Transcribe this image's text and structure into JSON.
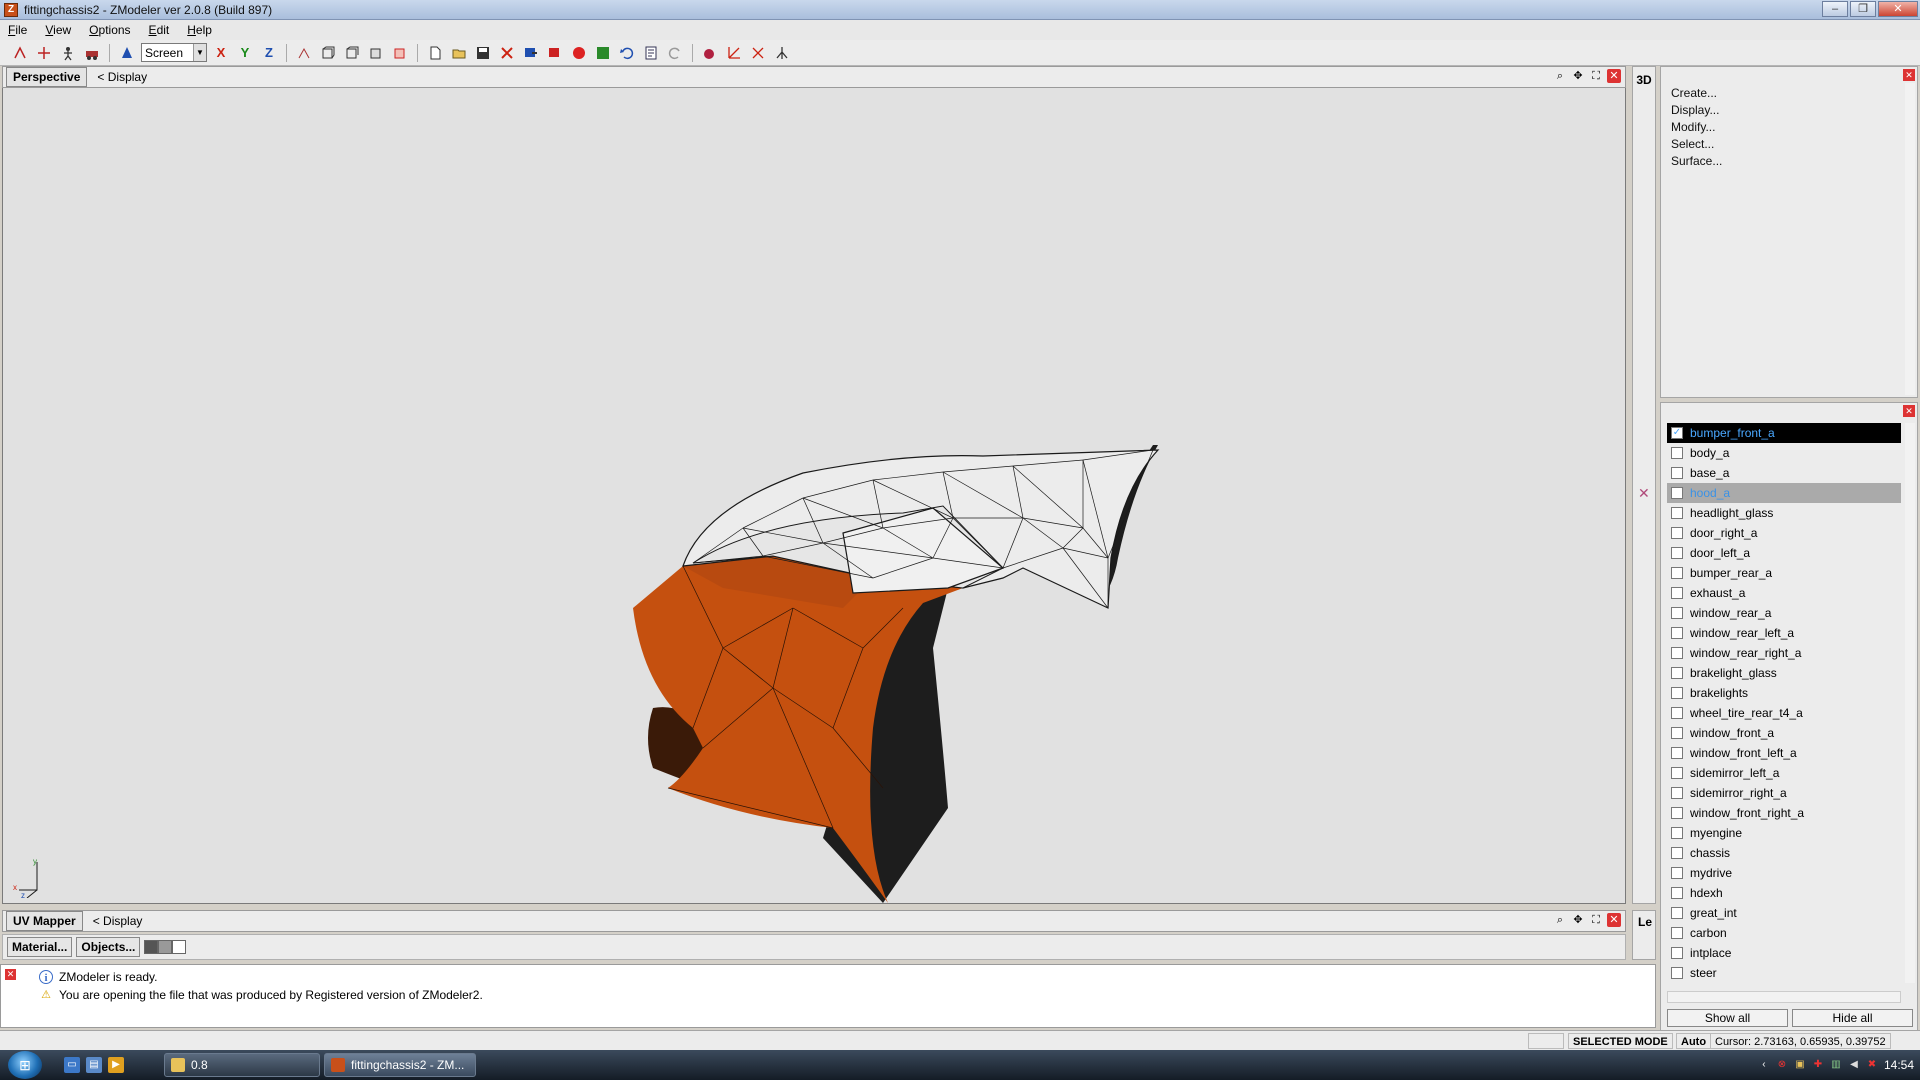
{
  "window": {
    "title": "fittingchassis2 - ZModeler ver 2.0.8 (Build 897)",
    "app_icon": "Z",
    "minimize": "–",
    "maximize": "❐",
    "close": "✕"
  },
  "menu": {
    "items": [
      {
        "key": "F",
        "rest": "ile"
      },
      {
        "key": "V",
        "rest": "iew"
      },
      {
        "key": "O",
        "rest": "ptions"
      },
      {
        "key": "E",
        "rest": "dit"
      },
      {
        "key": "H",
        "rest": "elp"
      }
    ]
  },
  "toolbar": {
    "space_select": "Screen",
    "axis_x": "X",
    "axis_y": "Y",
    "axis_z": "Z"
  },
  "viewport": {
    "tab": "Perspective",
    "display_label": "< Display",
    "mode_label": "3D",
    "colors": {
      "mesh_fill": "#c5500f",
      "background": "#e1e1e1",
      "wire": "#1a1a1a"
    }
  },
  "commands": {
    "items": [
      "Create...",
      "Display...",
      "Modify...",
      "Select...",
      "Surface..."
    ]
  },
  "objects": {
    "items": [
      {
        "name": "bumper_front_a",
        "checked": true,
        "state": "selected"
      },
      {
        "name": "body_a",
        "checked": false,
        "state": ""
      },
      {
        "name": "base_a",
        "checked": false,
        "state": ""
      },
      {
        "name": "hood_a",
        "checked": false,
        "state": "highlight"
      },
      {
        "name": "headlight_glass",
        "checked": false,
        "state": ""
      },
      {
        "name": "door_right_a",
        "checked": false,
        "state": ""
      },
      {
        "name": "door_left_a",
        "checked": false,
        "state": ""
      },
      {
        "name": "bumper_rear_a",
        "checked": false,
        "state": ""
      },
      {
        "name": "exhaust_a",
        "checked": false,
        "state": ""
      },
      {
        "name": "window_rear_a",
        "checked": false,
        "state": ""
      },
      {
        "name": "window_rear_left_a",
        "checked": false,
        "state": ""
      },
      {
        "name": "window_rear_right_a",
        "checked": false,
        "state": ""
      },
      {
        "name": "brakelight_glass",
        "checked": false,
        "state": ""
      },
      {
        "name": "brakelights",
        "checked": false,
        "state": ""
      },
      {
        "name": "wheel_tire_rear_t4_a",
        "checked": false,
        "state": ""
      },
      {
        "name": "window_front_a",
        "checked": false,
        "state": ""
      },
      {
        "name": "window_front_left_a",
        "checked": false,
        "state": ""
      },
      {
        "name": "sidemirror_left_a",
        "checked": false,
        "state": ""
      },
      {
        "name": "sidemirror_right_a",
        "checked": false,
        "state": ""
      },
      {
        "name": "window_front_right_a",
        "checked": false,
        "state": ""
      },
      {
        "name": "myengine",
        "checked": false,
        "state": ""
      },
      {
        "name": "chassis",
        "checked": false,
        "state": ""
      },
      {
        "name": "mydrive",
        "checked": false,
        "state": ""
      },
      {
        "name": "hdexh",
        "checked": false,
        "state": ""
      },
      {
        "name": "great_int",
        "checked": false,
        "state": ""
      },
      {
        "name": "carbon",
        "checked": false,
        "state": ""
      },
      {
        "name": "intplace",
        "checked": false,
        "state": ""
      },
      {
        "name": "steer",
        "checked": false,
        "state": ""
      }
    ],
    "show_all": "Show all",
    "hide_all": "Hide all"
  },
  "uv": {
    "tab": "UV Mapper",
    "display_label": "< Display",
    "material_button": "Material...",
    "objects_button": "Objects...",
    "side_label": "Le"
  },
  "log": {
    "lines": [
      {
        "icon": "info-icon",
        "text": "ZModeler is ready."
      },
      {
        "icon": "warning-icon",
        "text": "You are opening the file that was produced by Registered version of ZModeler2."
      }
    ]
  },
  "status": {
    "mode": "SELECTED MODE",
    "auto": "Auto",
    "cursor": "Cursor: 2.73163, 0.65935, 0.39752"
  },
  "taskbar": {
    "folder_task": "0.8",
    "app_task": "fittingchassis2 - ZM...",
    "clock": "14:54"
  }
}
